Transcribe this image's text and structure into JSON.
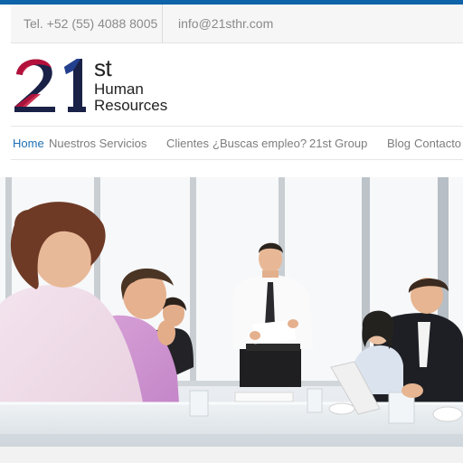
{
  "colors": {
    "accent": "#0f63a8",
    "active_nav": "#1f6fb2",
    "logo_navy": "#1a2147",
    "logo_crimson": "#c4103a",
    "logo_blue": "#23408f"
  },
  "header": {
    "phone": "Tel. +52 (55) 4088 8005",
    "email": "info@21sthr.com"
  },
  "logo": {
    "numeral": "21",
    "suffix": "st",
    "line1": "Human",
    "line2": "Resources"
  },
  "nav": {
    "items": [
      {
        "label": "Home",
        "active": true
      },
      {
        "label": "Nuestros Servicios"
      },
      {
        "label": "Clientes"
      },
      {
        "label": "¿Buscas empleo?"
      },
      {
        "label": "21st Group"
      },
      {
        "label": "Blog"
      },
      {
        "label": "Contacto"
      }
    ]
  },
  "hero": {
    "image": "business-meeting-photo"
  }
}
